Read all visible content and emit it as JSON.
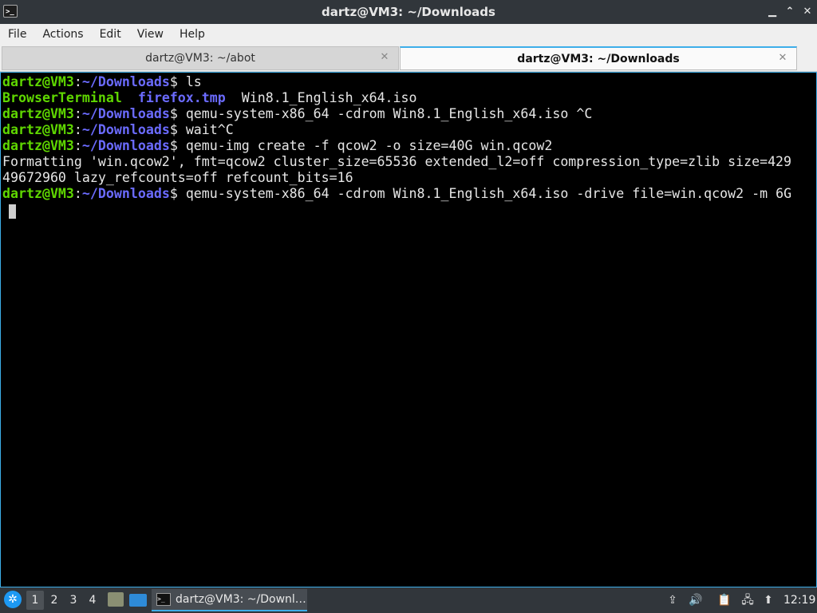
{
  "window": {
    "title": "dartz@VM3: ~/Downloads",
    "app_icon_glyph": ">_",
    "controls": {
      "minimize": "▁",
      "maximize": "⌃",
      "close": "✕"
    }
  },
  "menu": [
    "File",
    "Actions",
    "Edit",
    "View",
    "Help"
  ],
  "tabs": [
    {
      "label": "dartz@VM3: ~/abot",
      "active": false
    },
    {
      "label": "dartz@VM3: ~/Downloads",
      "active": true
    }
  ],
  "tab_close_glyph": "✕",
  "terminal": {
    "prompt_user": "dartz@VM3",
    "prompt_sep": ":",
    "prompt_path": "~/Downloads",
    "prompt_end": "$ ",
    "lines": [
      {
        "type": "prompt",
        "cmd": "ls"
      },
      {
        "type": "ls",
        "items": [
          {
            "name": "BrowserTerminal",
            "kind": "dir"
          },
          {
            "name": "firefox.tmp",
            "kind": "tmp"
          },
          {
            "name": "Win8.1_English_x64.iso",
            "kind": "file"
          }
        ]
      },
      {
        "type": "prompt",
        "cmd": "qemu-system-x86_64 -cdrom Win8.1_English_x64.iso ^C"
      },
      {
        "type": "prompt",
        "cmd": "wait^C"
      },
      {
        "type": "prompt",
        "cmd": "qemu-img create -f qcow2 -o size=40G win.qcow2"
      },
      {
        "type": "output",
        "text": "Formatting 'win.qcow2', fmt=qcow2 cluster_size=65536 extended_l2=off compression_type=zlib size=429"
      },
      {
        "type": "output",
        "text": "49672960 lazy_refcounts=off refcount_bits=16"
      },
      {
        "type": "prompt",
        "cmd": "qemu-system-x86_64 -cdrom Win8.1_English_x64.iso -drive file=win.qcow2 -m 6G"
      },
      {
        "type": "cursor"
      }
    ]
  },
  "taskbar": {
    "start_icon": "start-menu-icon",
    "workspaces": [
      "1",
      "2",
      "3",
      "4"
    ],
    "current_workspace": "1",
    "task_label": "dartz@VM3: ~/Downl…",
    "task_icon_glyph": ">_",
    "tray": {
      "upload": "⇪",
      "volume": "🔊",
      "clipboard": "📋",
      "network": "🖧",
      "updates": "⬆"
    },
    "clock": "12:19"
  },
  "colors": {
    "accent": "#3daee9",
    "prompt_user": "#5fd700",
    "prompt_path": "#6b6bff",
    "terminal_bg": "#000000",
    "chrome_dark": "#31363b"
  }
}
